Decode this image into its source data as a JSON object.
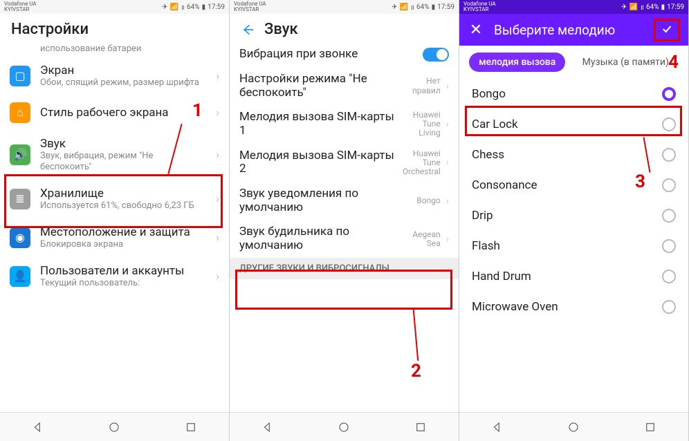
{
  "status": {
    "carrier": "Vodafone UA",
    "subcarrier": "KYIVSTAR",
    "signal": "64%",
    "time": "17:59"
  },
  "annotations": {
    "a1": "1",
    "a2": "2",
    "a3": "3",
    "a4": "4"
  },
  "p1": {
    "header": "Настройки",
    "partial_top": "использование батареи",
    "items": [
      {
        "icon": "blue",
        "glyph": "▢",
        "title": "Экран",
        "sub": "Обои, спящий режим, размер шрифта"
      },
      {
        "icon": "orange",
        "glyph": "⌂",
        "title": "Стиль рабочего экрана",
        "sub": ""
      },
      {
        "icon": "green",
        "glyph": "🔊",
        "title": "Звук",
        "sub": "Звук, вибрация, режим \"Не беспокоить\""
      },
      {
        "icon": "grey",
        "glyph": "≣",
        "title": "Хранилище",
        "sub": "Используется 61%, свободно 6,23 ГБ"
      },
      {
        "icon": "dblue",
        "glyph": "◉",
        "title": "Местоположение и защита",
        "sub": "Блокировка экрана"
      },
      {
        "icon": "lblue",
        "glyph": "👤",
        "title": "Пользователи и аккаунты",
        "sub": "Текущий пользователь:"
      }
    ]
  },
  "p2": {
    "header": "Звук",
    "rows": [
      {
        "title": "Вибрация при звонке",
        "toggle": true
      },
      {
        "title": "Настройки режима \"Не беспокоить\"",
        "val": "Нет правил"
      },
      {
        "title": "Мелодия вызова SIM-карты 1",
        "val": "Huawei Tune Living"
      },
      {
        "title": "Мелодия вызова SIM-карты 2",
        "val": "Huawei Tune Orchestral"
      },
      {
        "title": "Звук уведомления по умолчанию",
        "val": "Bongo"
      },
      {
        "title": "Звук будильника по умолчанию",
        "val": "Aegean Sea"
      }
    ],
    "section": "ДРУГИЕ ЗВУКИ И ВИБРОСИГНАЛЫ"
  },
  "p3": {
    "header": "Выберите мелодию",
    "tabs": {
      "active": "мелодия вызова",
      "inactive": "Музыка (в памяти)"
    },
    "rings": [
      "Bongo",
      "Car Lock",
      "Chess",
      "Consonance",
      "Drip",
      "Flash",
      "Hand Drum",
      "Microwave Oven"
    ],
    "selected": 0
  }
}
